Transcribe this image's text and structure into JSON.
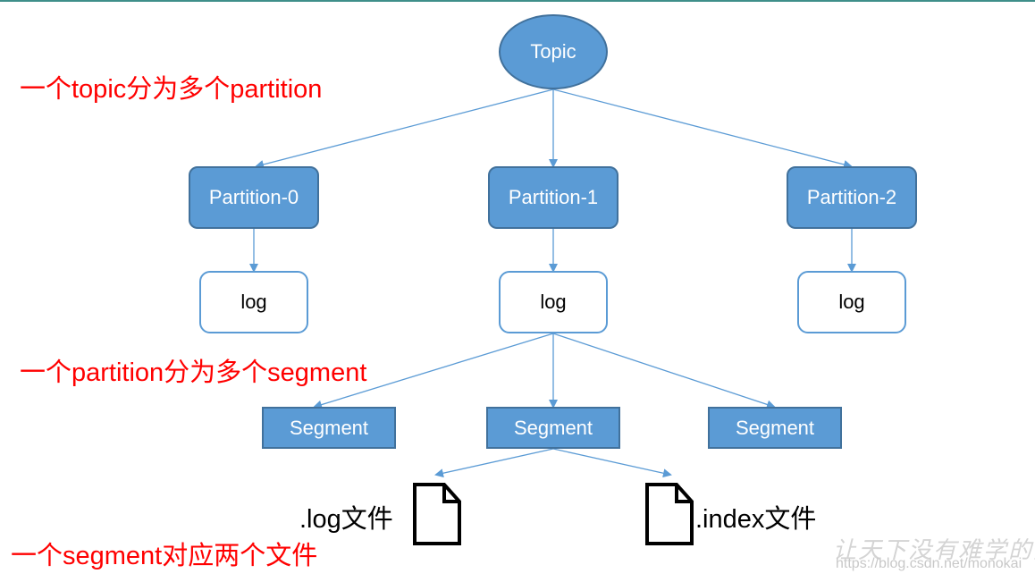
{
  "diagram": {
    "topic": {
      "label": "Topic"
    },
    "partitions": [
      {
        "label": "Partition-0",
        "log_label": "log"
      },
      {
        "label": "Partition-1",
        "log_label": "log"
      },
      {
        "label": "Partition-2",
        "log_label": "log"
      }
    ],
    "segments": [
      {
        "label": "Segment"
      },
      {
        "label": "Segment"
      },
      {
        "label": "Segment"
      }
    ],
    "files": [
      {
        "label": ".log文件",
        "icon": "file-icon"
      },
      {
        "label": ".index文件",
        "icon": "file-icon"
      }
    ],
    "annotations": [
      "一个topic分为多个partition",
      "一个partition分为多个segment",
      "一个segment对应两个文件"
    ],
    "colors": {
      "node_fill": "#5b9bd5",
      "node_border": "#41719c",
      "annotation": "#ff0000",
      "edge": "#5b9bd5"
    }
  },
  "watermark": {
    "slogan": "让天下没有难学的技术",
    "url": "https://blog.csdn.net/monokai"
  }
}
